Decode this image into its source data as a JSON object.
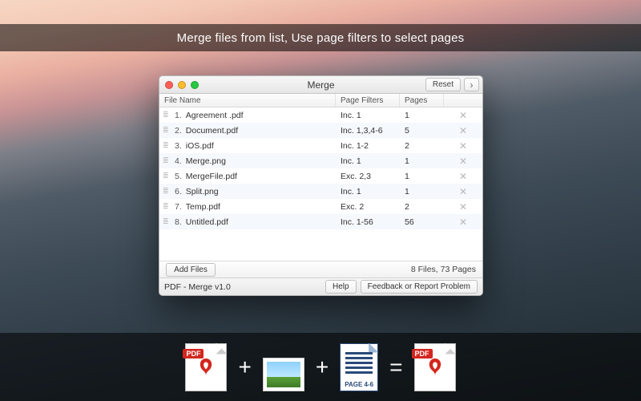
{
  "banner_text": "Merge files from list, Use page filters to select pages",
  "window": {
    "title": "Merge",
    "reset_label": "Reset",
    "next_glyph": "›"
  },
  "columns": {
    "name": "File Name",
    "filter": "Page Filters",
    "pages": "Pages"
  },
  "rows": [
    {
      "idx": "1.",
      "name": "Agreement .pdf",
      "filter": "Inc. 1",
      "pages": "1"
    },
    {
      "idx": "2.",
      "name": "Document.pdf",
      "filter": "Inc. 1,3,4-6",
      "pages": "5"
    },
    {
      "idx": "3.",
      "name": "iOS.pdf",
      "filter": "Inc. 1-2",
      "pages": "2"
    },
    {
      "idx": "4.",
      "name": "Merge.png",
      "filter": "Inc. 1",
      "pages": "1"
    },
    {
      "idx": "5.",
      "name": "MergeFile.pdf",
      "filter": "Exc. 2,3",
      "pages": "1"
    },
    {
      "idx": "6.",
      "name": "Split.png",
      "filter": "Inc. 1",
      "pages": "1"
    },
    {
      "idx": "7.",
      "name": "Temp.pdf",
      "filter": "Exc. 2",
      "pages": "2"
    },
    {
      "idx": "8.",
      "name": "Untitled.pdf",
      "filter": "Inc. 1-56",
      "pages": "56"
    }
  ],
  "footer": {
    "add_files": "Add Files",
    "summary": "8 Files, 73 Pages",
    "app": "PDF - Merge v1.0",
    "help": "Help",
    "feedback": "Feedback or Report Problem"
  },
  "formula": {
    "pdf_tag": "PDF",
    "page_caption": "PAGE 4-6",
    "plus": "+",
    "equals": "="
  }
}
